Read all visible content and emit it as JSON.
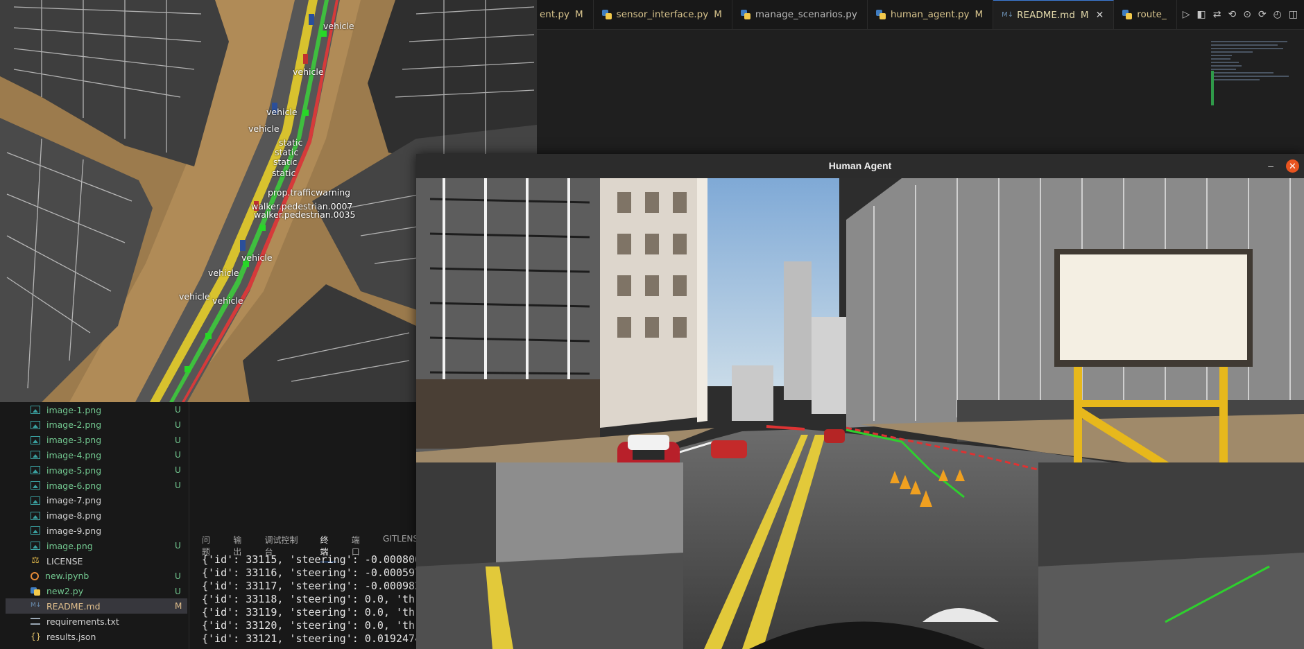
{
  "tabs": [
    {
      "label": "ent.py",
      "status": "M",
      "kind": "py",
      "first": true
    },
    {
      "label": "sensor_interface.py",
      "status": "M",
      "kind": "py"
    },
    {
      "label": "manage_scenarios.py",
      "status": "",
      "kind": "py",
      "plain": true
    },
    {
      "label": "human_agent.py",
      "status": "M",
      "kind": "py"
    },
    {
      "label": "README.md",
      "status": "M",
      "kind": "md",
      "active": true
    },
    {
      "label": "route_",
      "status": "",
      "kind": "py"
    }
  ],
  "window": {
    "title": "Human Agent",
    "minimize": "–",
    "close": "✕"
  },
  "bev_labels": [
    "vehicle",
    "vehicle",
    "vehicle",
    "vehicle",
    "static",
    "static",
    "static",
    "static",
    "prop.trafficwarning",
    "walker.pedestrian.0007",
    "walker.pedestrian.0035",
    "vehicle",
    "vehicle",
    "vehicle",
    "vehicle"
  ],
  "files": [
    {
      "name": "image-1.png",
      "status": "U",
      "icon": "image-icon"
    },
    {
      "name": "image-2.png",
      "status": "U",
      "icon": "image-icon"
    },
    {
      "name": "image-3.png",
      "status": "U",
      "icon": "image-icon"
    },
    {
      "name": "image-4.png",
      "status": "U",
      "icon": "image-icon"
    },
    {
      "name": "image-5.png",
      "status": "U",
      "icon": "image-icon"
    },
    {
      "name": "image-6.png",
      "status": "U",
      "icon": "image-icon"
    },
    {
      "name": "image-7.png",
      "status": "",
      "icon": "image-icon"
    },
    {
      "name": "image-8.png",
      "status": "",
      "icon": "image-icon"
    },
    {
      "name": "image-9.png",
      "status": "",
      "icon": "image-icon"
    },
    {
      "name": "image.png",
      "status": "U",
      "icon": "image-icon"
    },
    {
      "name": "LICENSE",
      "status": "",
      "icon": "license-icon"
    },
    {
      "name": "new.ipynb",
      "status": "U",
      "icon": "notebook-icon"
    },
    {
      "name": "new2.py",
      "status": "U",
      "icon": "python-icon"
    },
    {
      "name": "README.md",
      "status": "M",
      "icon": "markdown-icon",
      "selected": true
    },
    {
      "name": "requirements.txt",
      "status": "",
      "icon": "text-icon"
    },
    {
      "name": "results.json",
      "status": "",
      "icon": "json-icon"
    }
  ],
  "panel_tabs": [
    "问题",
    "输出",
    "调试控制台",
    "终端",
    "端口",
    "GITLENS"
  ],
  "panel_active": "终端",
  "terminal_lines": [
    "{'id': 33115, 'steering': -0.000800",
    "{'id': 33116, 'steering': -0.000597",
    "{'id': 33117, 'steering': -0.000982",
    "{'id': 33118, 'steering': 0.0, 'th",
    "{'id': 33119, 'steering': 0.0, 'th",
    "{'id': 33120, 'steering': 0.0, 'th",
    "{'id': 33121, 'steering': 0.0192474"
  ],
  "colors": {
    "untracked": "#73c991",
    "modified": "#e2c08d",
    "accent": "#3d7bd8",
    "close_button": "#e9541f"
  }
}
